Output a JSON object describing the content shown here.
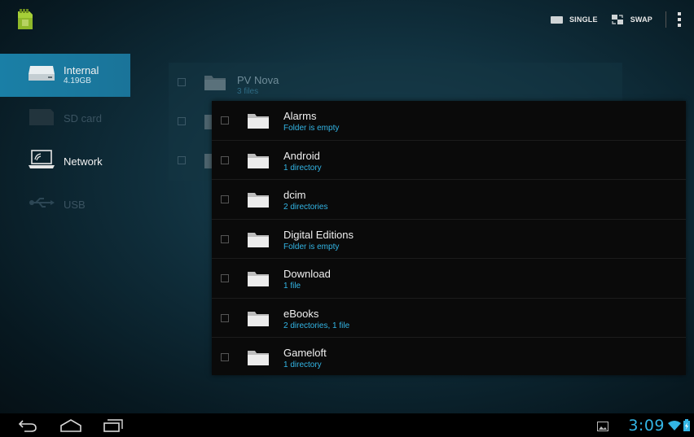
{
  "action_bar": {
    "app_icon": "sd-card-app-icon",
    "single_label": "SINGLE",
    "swap_label": "SWAP",
    "single_icon": "single-pane-icon",
    "swap_icon": "swap-icon",
    "overflow_icon": "overflow-menu-icon"
  },
  "sidebar": {
    "items": [
      {
        "label": "Internal",
        "sub": "4.19GB",
        "icon": "internal-storage-icon",
        "selected": true
      },
      {
        "label": "SD card",
        "sub": "",
        "icon": "sd-card-icon",
        "disabled": true
      },
      {
        "label": "Network",
        "sub": "",
        "icon": "laptop-icon"
      },
      {
        "label": "USB",
        "sub": "",
        "icon": "usb-icon",
        "disabled": true
      }
    ]
  },
  "back_list": {
    "rows": [
      {
        "name": "PV Nova",
        "meta": "3 files"
      }
    ]
  },
  "front_list": {
    "rows": [
      {
        "name": "Alarms",
        "meta": "Folder is empty"
      },
      {
        "name": "Android",
        "meta": "1 directory"
      },
      {
        "name": "dcim",
        "meta": "2 directories"
      },
      {
        "name": "Digital Editions",
        "meta": "Folder is empty"
      },
      {
        "name": "Download",
        "meta": "1 file"
      },
      {
        "name": "eBooks",
        "meta": "2 directories, 1 file"
      },
      {
        "name": "Gameloft",
        "meta": "1 directory"
      }
    ]
  },
  "nav_bar": {
    "back_icon": "back-icon",
    "home_icon": "home-icon",
    "recents_icon": "recent-apps-icon",
    "time": "3:09",
    "gallery_icon": "gallery-notification-icon",
    "wifi_icon": "wifi-icon",
    "battery_icon": "battery-icon"
  },
  "colors": {
    "accent": "#33b5e5",
    "selected": "#1a7fa6",
    "panel": "#0a0a0a"
  }
}
